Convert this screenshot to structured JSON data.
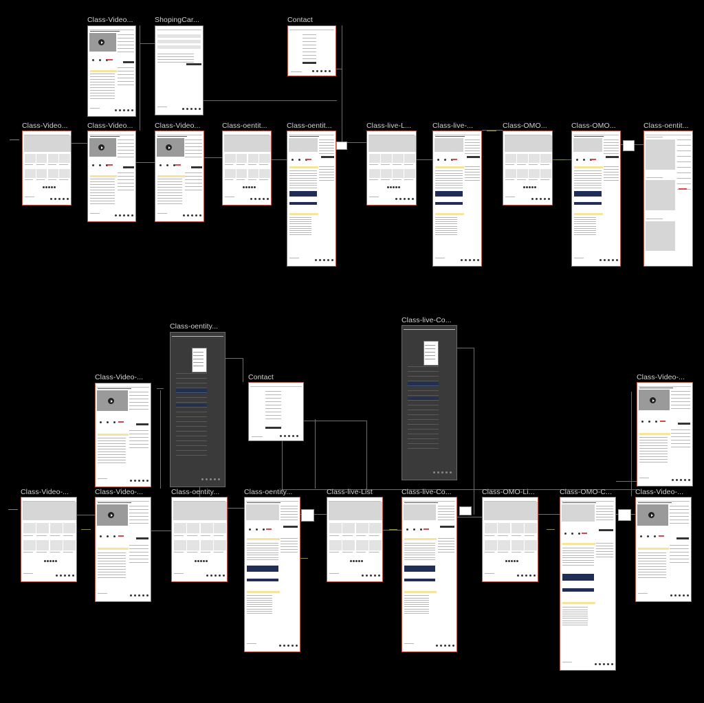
{
  "canvas": {
    "background": "#000000",
    "frame_border": "#c8574a"
  },
  "frames": [
    {
      "title": "Class-Video...",
      "kind": "video-detail"
    },
    {
      "title": "ShopingCar...",
      "kind": "cart"
    },
    {
      "title": "Contact",
      "kind": "contact"
    },
    {
      "title": "Class-Video...",
      "kind": "list"
    },
    {
      "title": "Class-Video...",
      "kind": "video-detail"
    },
    {
      "title": "Class-Video...",
      "kind": "video-detail"
    },
    {
      "title": "Class-oentit...",
      "kind": "list"
    },
    {
      "title": "Class-oentit...",
      "kind": "detail-long"
    },
    {
      "title": "Class-live-L...",
      "kind": "list"
    },
    {
      "title": "Class-live-...",
      "kind": "detail-long"
    },
    {
      "title": "Class-OMO...",
      "kind": "list"
    },
    {
      "title": "Class-OMO...",
      "kind": "detail-long"
    },
    {
      "title": "Class-oentit...",
      "kind": "gallery"
    },
    {
      "title": "Class-oentity...",
      "kind": "overlay"
    },
    {
      "title": "Class-live-Co...",
      "kind": "overlay"
    },
    {
      "title": "Class-Video-...",
      "kind": "video-detail"
    },
    {
      "title": "Contact",
      "kind": "contact"
    },
    {
      "title": "Class-Video-...",
      "kind": "video-detail"
    },
    {
      "title": "Class-Video-...",
      "kind": "list"
    },
    {
      "title": "Class-Video-...",
      "kind": "video-detail"
    },
    {
      "title": "Class-oentity...",
      "kind": "list"
    },
    {
      "title": "Class-oentity...",
      "kind": "detail-long"
    },
    {
      "title": "Class-live-List",
      "kind": "list"
    },
    {
      "title": "Class-live-Co...",
      "kind": "detail-long"
    },
    {
      "title": "Class-OMO-Li...",
      "kind": "list"
    },
    {
      "title": "Class-OMO-C...",
      "kind": "detail-long"
    },
    {
      "title": "Class-Video-...",
      "kind": "video-detail"
    }
  ]
}
